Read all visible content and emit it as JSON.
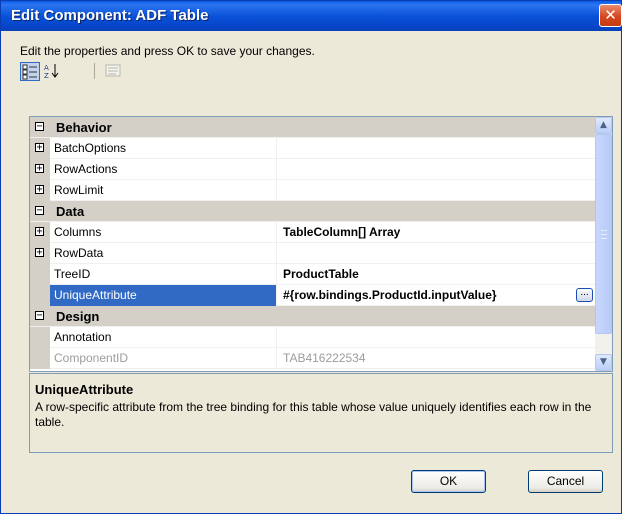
{
  "window": {
    "title": "Edit Component: ADF Table",
    "close_glyph": "✕"
  },
  "instructions": "Edit the properties and press OK to save your changes.",
  "toolbar": {
    "icons": [
      "categorized-icon",
      "alphabetical-icon",
      "property-pages-icon"
    ],
    "alpha_glyph": "A Z"
  },
  "property_grid": {
    "rows": [
      {
        "kind": "category",
        "name": "Behavior",
        "expander": "−"
      },
      {
        "kind": "property",
        "name": "BatchOptions",
        "value": "",
        "expander": "+"
      },
      {
        "kind": "property",
        "name": "RowActions",
        "value": "",
        "expander": "+"
      },
      {
        "kind": "property",
        "name": "RowLimit",
        "value": "",
        "expander": "+"
      },
      {
        "kind": "category",
        "name": "Data",
        "expander": "−"
      },
      {
        "kind": "property",
        "name": "Columns",
        "value": "TableColumn[] Array",
        "expander": "+"
      },
      {
        "kind": "property",
        "name": "RowData",
        "value": "",
        "expander": "+"
      },
      {
        "kind": "property",
        "name": "TreeID",
        "value": "ProductTable",
        "expander": ""
      },
      {
        "kind": "property",
        "name": "UniqueAttribute",
        "value": "#{row.bindings.ProductId.inputValue}",
        "expander": "",
        "selected": true,
        "ellipsis": "..."
      },
      {
        "kind": "category",
        "name": "Design",
        "expander": "−"
      },
      {
        "kind": "property",
        "name": "Annotation",
        "value": "",
        "expander": ""
      },
      {
        "kind": "property",
        "name": "ComponentID",
        "value": "TAB416222534",
        "expander": "",
        "disabled": true
      }
    ],
    "scroll_up_glyph": "▲",
    "scroll_down_glyph": "▼"
  },
  "description": {
    "title": "UniqueAttribute",
    "text": "A row-specific attribute from the tree binding for this table whose value uniquely identifies each row in the table."
  },
  "buttons": {
    "ok": "OK",
    "cancel": "Cancel"
  },
  "colors": {
    "titlebar": "#0a52d8",
    "selection": "#316ac5",
    "dialog_bg": "#ece9d8",
    "grid_border": "#7f9db9",
    "category_bg": "#d4d0c8"
  }
}
